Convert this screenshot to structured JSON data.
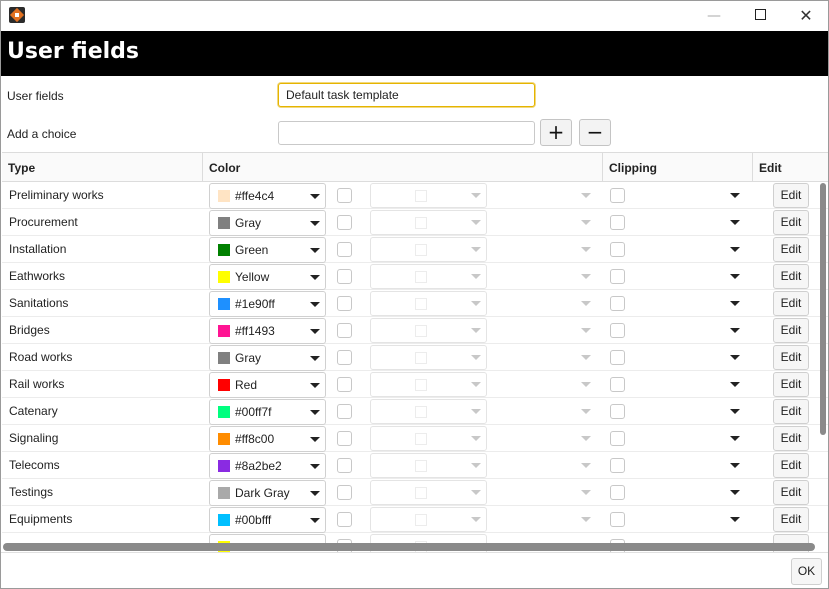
{
  "window": {
    "title": "",
    "minimize_glyph": "—",
    "close_glyph": "✕"
  },
  "header": {
    "title": "User fields"
  },
  "form": {
    "user_fields_label": "User fields",
    "user_fields_value": "Default task template",
    "add_choice_label": "Add a choice",
    "add_choice_value": "",
    "add_button": "+",
    "remove_button": "−"
  },
  "grid": {
    "columns": [
      "Type",
      "Color",
      "Clipping",
      "Edit"
    ],
    "edit_label": "Edit",
    "rows": [
      {
        "type": "Preliminary works",
        "color_name": "#ffe4c4",
        "swatch": "#ffe4c4"
      },
      {
        "type": "Procurement",
        "color_name": "Gray",
        "swatch": "#808080"
      },
      {
        "type": "Installation",
        "color_name": "Green",
        "swatch": "#008000"
      },
      {
        "type": "Eathworks",
        "color_name": "Yellow",
        "swatch": "#ffff00"
      },
      {
        "type": "Sanitations",
        "color_name": "#1e90ff",
        "swatch": "#1e90ff"
      },
      {
        "type": "Bridges",
        "color_name": "#ff1493",
        "swatch": "#ff1493"
      },
      {
        "type": "Road works",
        "color_name": "Gray",
        "swatch": "#808080"
      },
      {
        "type": "Rail works",
        "color_name": "Red",
        "swatch": "#ff0000"
      },
      {
        "type": "Catenary",
        "color_name": "#00ff7f",
        "swatch": "#00ff7f"
      },
      {
        "type": "Signaling",
        "color_name": "#ff8c00",
        "swatch": "#ff8c00"
      },
      {
        "type": "Telecoms",
        "color_name": "#8a2be2",
        "swatch": "#8a2be2"
      },
      {
        "type": "Testings",
        "color_name": "Dark Gray",
        "swatch": "#a9a9a9"
      },
      {
        "type": "Equipments",
        "color_name": "#00bfff",
        "swatch": "#00bfff"
      },
      {
        "type": "",
        "color_name": "",
        "swatch": "#ffff00"
      }
    ]
  },
  "footer": {
    "ok_label": "OK"
  },
  "colors": {
    "header_bg": "#000000",
    "focus_border": "#e5b400"
  }
}
